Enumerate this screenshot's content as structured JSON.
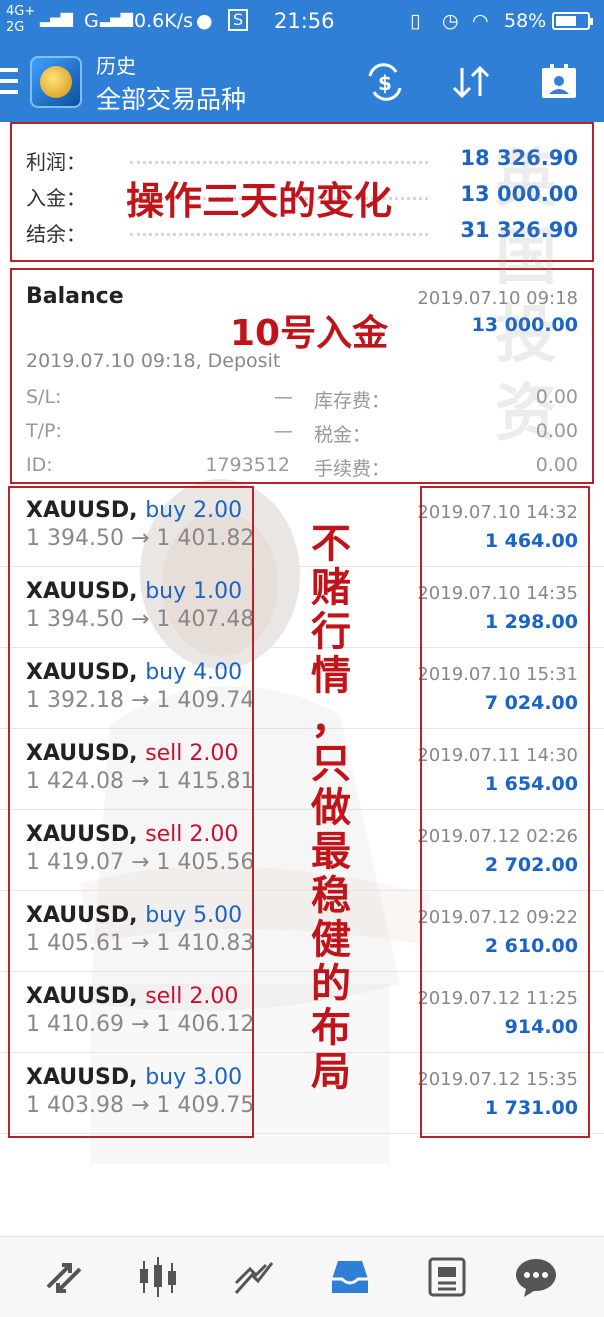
{
  "statusbar": {
    "network1": "4G+",
    "network2": "2G",
    "carrier": "G",
    "speed": "0.6K/s",
    "time": "21:56",
    "battery": "58%"
  },
  "appbar": {
    "title_small": "历史",
    "title_large": "全部交易品种"
  },
  "summary": {
    "rows": [
      {
        "label": "利润：",
        "value": "18 326.90"
      },
      {
        "label": "入金：",
        "value": "13 000.00"
      },
      {
        "label": "结余：",
        "value": "31 326.90"
      }
    ],
    "annotation": "操作三天的变化"
  },
  "balance": {
    "name": "Balance",
    "time": "2019.07.10 09:18",
    "amount": "13 000.00",
    "annotation": "10号入金",
    "description": "2019.07.10 09:18, Deposit",
    "sl_label": "S/L:",
    "sl_value": "—",
    "tp_label": "T/P:",
    "tp_value": "—",
    "id_label": "ID:",
    "id_value": "1793512",
    "swap_label": "库存费：",
    "swap_value": "0.00",
    "tax_label": "税金：",
    "tax_value": "0.00",
    "fee_label": "手续费：",
    "fee_value": "0.00"
  },
  "trades": [
    {
      "symbol": "XAUUSD,",
      "dir": "buy 2.00",
      "type": "buy",
      "price": "1 394.50 → 1 401.82",
      "time": "2019.07.10 14:32",
      "profit": "1 464.00"
    },
    {
      "symbol": "XAUUSD,",
      "dir": "buy 1.00",
      "type": "buy",
      "price": "1 394.50 → 1 407.48",
      "time": "2019.07.10 14:35",
      "profit": "1 298.00"
    },
    {
      "symbol": "XAUUSD,",
      "dir": "buy 4.00",
      "type": "buy",
      "price": "1 392.18 → 1 409.74",
      "time": "2019.07.10 15:31",
      "profit": "7 024.00"
    },
    {
      "symbol": "XAUUSD,",
      "dir": "sell 2.00",
      "type": "sell",
      "price": "1 424.08 → 1 415.81",
      "time": "2019.07.11 14:30",
      "profit": "1 654.00"
    },
    {
      "symbol": "XAUUSD,",
      "dir": "sell 2.00",
      "type": "sell",
      "price": "1 419.07 → 1 405.56",
      "time": "2019.07.12 02:26",
      "profit": "2 702.00"
    },
    {
      "symbol": "XAUUSD,",
      "dir": "buy 5.00",
      "type": "buy",
      "price": "1 405.61 → 1 410.83",
      "time": "2019.07.12 09:22",
      "profit": "2 610.00"
    },
    {
      "symbol": "XAUUSD,",
      "dir": "sell 2.00",
      "type": "sell",
      "price": "1 410.69 → 1 406.12",
      "time": "2019.07.12 11:25",
      "profit": "914.00"
    },
    {
      "symbol": "XAUUSD,",
      "dir": "buy 3.00",
      "type": "buy",
      "price": "1 403.98 → 1 409.75",
      "time": "2019.07.12 15:35",
      "profit": "1 731.00"
    }
  ],
  "annotation_vertical": "不赌行情，只做最稳健的布局",
  "watermark": "英国投资",
  "colors": {
    "accent": "#2f7fd6",
    "profit": "#1a63c7",
    "sell": "#c8102e",
    "annotation": "#c0141a"
  },
  "nav": [
    {
      "icon": "quotes-icon"
    },
    {
      "icon": "chart-icon"
    },
    {
      "icon": "trade-icon"
    },
    {
      "icon": "history-icon",
      "active": true
    },
    {
      "icon": "news-icon"
    },
    {
      "icon": "messages-icon"
    }
  ]
}
